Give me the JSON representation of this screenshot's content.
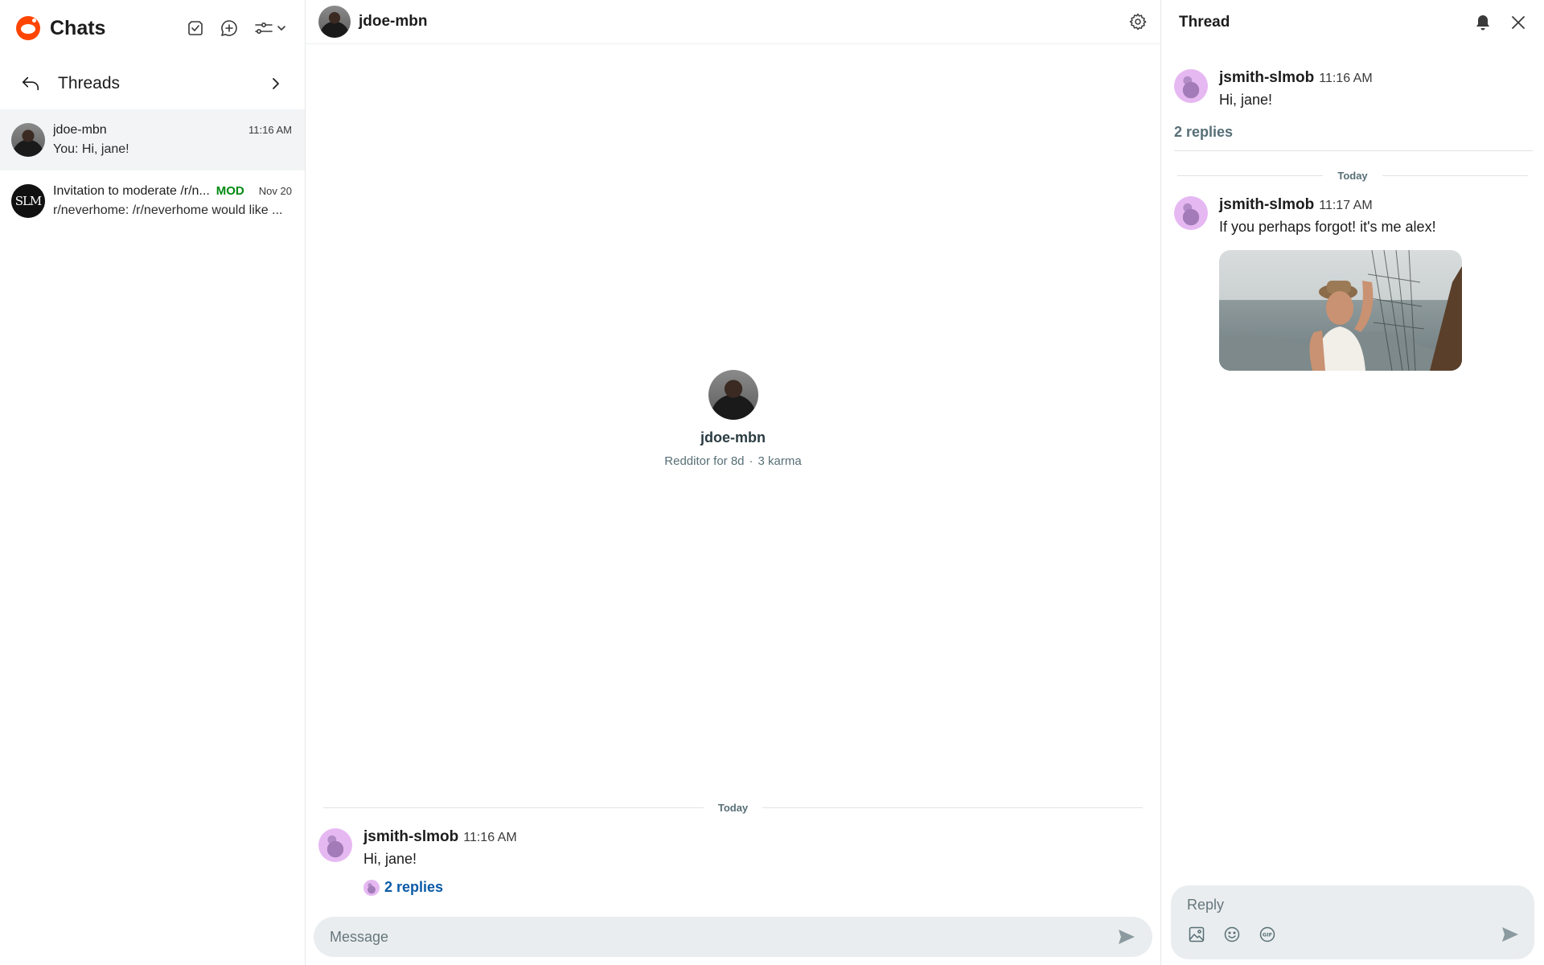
{
  "sidebar": {
    "title": "Chats",
    "threads_label": "Threads",
    "chats": [
      {
        "name": "jdoe-mbn",
        "time": "11:16 AM",
        "preview": "You: Hi, jane!",
        "badge": ""
      },
      {
        "name": "Invitation to moderate /r/n...",
        "time": "Nov 20",
        "preview": "r/neverhome: /r/neverhome would like ...",
        "badge": "MOD",
        "avatar_text": "SLM"
      }
    ]
  },
  "main": {
    "header_name": "jdoe-mbn",
    "profile": {
      "name": "jdoe-mbn",
      "age": "Redditor for 8d",
      "separator": "·",
      "karma": "3 karma"
    },
    "day_divider": "Today",
    "message": {
      "author": "jsmith-slmob",
      "time": "11:16 AM",
      "text": "Hi, jane!",
      "replies": "2 replies"
    },
    "composer_placeholder": "Message"
  },
  "thread": {
    "title": "Thread",
    "parent": {
      "author": "jsmith-slmob",
      "time": "11:16 AM",
      "text": "Hi, jane!"
    },
    "replies_count": "2 replies",
    "day_divider": "Today",
    "reply": {
      "author": "jsmith-slmob",
      "time": "11:17 AM",
      "text": "If you perhaps forgot! it's me alex!"
    },
    "reply_placeholder": "Reply"
  },
  "colors": {
    "accent": "#ff4500",
    "mod": "#008a10",
    "link": "#0b5aa6",
    "composer_bg": "#eaedef",
    "active_row": "#f2f4f5"
  },
  "icons": [
    "reddit-logo-icon",
    "mark-read-icon",
    "new-chat-icon",
    "filter-icon",
    "chevron-down-icon",
    "back-arrow-icon",
    "chevron-right-icon",
    "gear-icon",
    "bell-icon",
    "close-icon",
    "send-icon",
    "image-icon",
    "emoji-icon",
    "gif-icon"
  ]
}
